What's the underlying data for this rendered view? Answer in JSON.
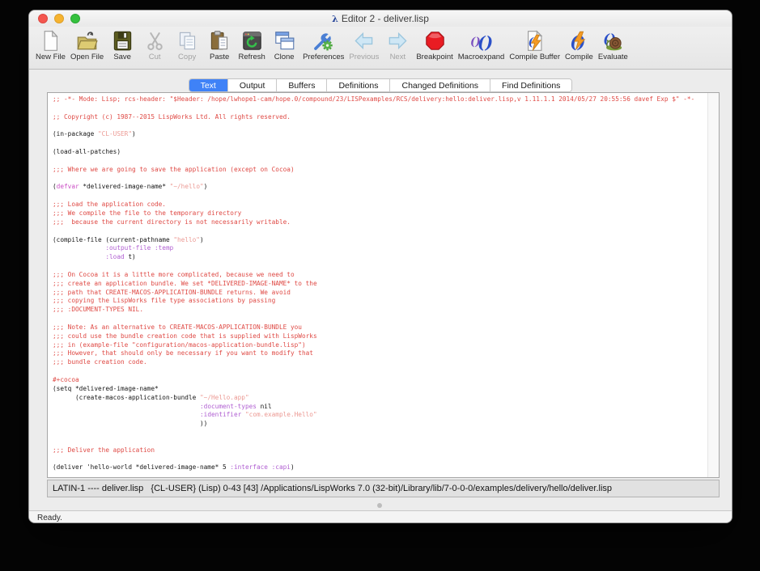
{
  "window": {
    "title": "Editor 2 - deliver.lisp",
    "title_icon": "lambda-icon"
  },
  "toolbar": {
    "items": [
      {
        "label": "New File",
        "icon": "new-file",
        "disabled": false
      },
      {
        "label": "Open File",
        "icon": "open-file",
        "disabled": false
      },
      {
        "label": "Save",
        "icon": "save",
        "disabled": false
      },
      {
        "label": "Cut",
        "icon": "cut",
        "disabled": true
      },
      {
        "label": "Copy",
        "icon": "copy",
        "disabled": true
      },
      {
        "label": "Paste",
        "icon": "paste",
        "disabled": false
      },
      {
        "label": "Refresh",
        "icon": "refresh",
        "disabled": false
      },
      {
        "label": "Clone",
        "icon": "clone",
        "disabled": false
      },
      {
        "label": "Preferences",
        "icon": "preferences",
        "disabled": false
      },
      {
        "label": "Previous",
        "icon": "previous",
        "disabled": true
      },
      {
        "label": "Next",
        "icon": "next",
        "disabled": true
      },
      {
        "label": "Breakpoint",
        "icon": "breakpoint",
        "disabled": false
      },
      {
        "label": "Macroexpand",
        "icon": "macroexpand",
        "disabled": false
      },
      {
        "label": "Compile Buffer",
        "icon": "compile-buffer",
        "disabled": false
      },
      {
        "label": "Compile",
        "icon": "compile",
        "disabled": false
      },
      {
        "label": "Evaluate",
        "icon": "evaluate",
        "disabled": false
      }
    ]
  },
  "tabs": {
    "items": [
      "Text",
      "Output",
      "Buffers",
      "Definitions",
      "Changed Definitions",
      "Find Definitions"
    ],
    "selected": "Text"
  },
  "editor": {
    "lines": [
      [
        [
          "cm",
          ";; -*- Mode: Lisp; rcs-header: \"$Header: /hope/lwhope1-cam/hope.0/compound/23/LISPexamples/RCS/delivery:hello:deliver.lisp,v 1.11.1.1 2014/05/27 20:55:56 davef Exp $\" -*-"
        ]
      ],
      [],
      [
        [
          "cm",
          ";; Copyright (c) 1987--2015 LispWorks Ltd. All rights reserved."
        ]
      ],
      [],
      [
        [
          "p",
          "(in-package "
        ],
        [
          "s",
          "\"CL-USER\""
        ],
        [
          "p",
          ")"
        ]
      ],
      [],
      [
        [
          "p",
          "(load-all-patches)"
        ]
      ],
      [],
      [
        [
          "cm",
          ";;; Where we are going to save the application (except on Cocoa)"
        ]
      ],
      [],
      [
        [
          "p",
          "("
        ],
        [
          "d",
          "defvar"
        ],
        [
          "p",
          " *delivered-image-name* "
        ],
        [
          "s",
          "\"~/hello\""
        ],
        [
          "p",
          ")"
        ]
      ],
      [],
      [
        [
          "cm",
          ";;; Load the application code."
        ]
      ],
      [
        [
          "cm",
          ";;; We compile the file to the temporary directory"
        ]
      ],
      [
        [
          "cm",
          ";;;  because the current directory is not necessarily writable."
        ]
      ],
      [],
      [
        [
          "p",
          "(compile-file (current-pathname "
        ],
        [
          "s",
          "\"hello\""
        ],
        [
          "p",
          ")"
        ]
      ],
      [
        [
          "k",
          "              :output-file :temp"
        ]
      ],
      [
        [
          "k",
          "              :load "
        ],
        [
          "p",
          "t)"
        ]
      ],
      [],
      [
        [
          "cm",
          ";;; On Cocoa it is a little more complicated, because we need to"
        ]
      ],
      [
        [
          "cm",
          ";;; create an application bundle. We set *DELIVERED-IMAGE-NAME* to the"
        ]
      ],
      [
        [
          "cm",
          ";;; path that CREATE-MACOS-APPLICATION-BUNDLE returns. We avoid"
        ]
      ],
      [
        [
          "cm",
          ";;; copying the LispWorks file type associations by passing"
        ]
      ],
      [
        [
          "cm",
          ";;; :DOCUMENT-TYPES NIL."
        ]
      ],
      [],
      [
        [
          "cm",
          ";;; Note: As an alternative to CREATE-MACOS-APPLICATION-BUNDLE you"
        ]
      ],
      [
        [
          "cm",
          ";;; could use the bundle creation code that is supplied with LispWorks"
        ]
      ],
      [
        [
          "cm",
          ";;; in (example-file \"configuration/macos-application-bundle.lisp\")"
        ]
      ],
      [
        [
          "cm",
          ";;; However, that should only be necessary if you want to modify that"
        ]
      ],
      [
        [
          "cm",
          ";;; bundle creation code."
        ]
      ],
      [],
      [
        [
          "cm",
          "#+cocoa"
        ]
      ],
      [
        [
          "p",
          "(setq *delivered-image-name*"
        ]
      ],
      [
        [
          "p",
          "      (create-macos-application-bundle "
        ],
        [
          "s",
          "\"~/Hello.app\""
        ]
      ],
      [
        [
          "p",
          "                                       "
        ],
        [
          "k",
          ":document-types "
        ],
        [
          "p",
          "nil"
        ]
      ],
      [
        [
          "p",
          "                                       "
        ],
        [
          "k",
          ":identifier "
        ],
        [
          "s",
          "\"com.example.Hello\""
        ]
      ],
      [
        [
          "p",
          "                                       ))"
        ]
      ],
      [],
      [],
      [
        [
          "cm",
          ";;; Deliver the application"
        ]
      ],
      [],
      [
        [
          "p",
          "(deliver 'hello-world *delivered-image-name* 5 "
        ],
        [
          "k",
          ":interface :capi"
        ],
        [
          "p",
          ")"
        ]
      ]
    ]
  },
  "status_bar": {
    "text": "LATIN-1 ---- deliver.lisp   {CL-USER} (Lisp) 0-43 [43] /Applications/LispWorks 7.0 (32-bit)/Library/lib/7-0-0-0/examples/delivery/hello/deliver.lisp"
  },
  "echo_area": {
    "text": "Ready."
  },
  "colors": {
    "comment": "#df4a45",
    "string": "#ec9a94",
    "keyword": "#b160d2",
    "defform": "#cb4fc5",
    "tab_selected": "#3f82f7",
    "breakpoint_red": "#e91c23",
    "paren_blue": "#2b50c8",
    "bolt_orange": "#f59a23"
  }
}
